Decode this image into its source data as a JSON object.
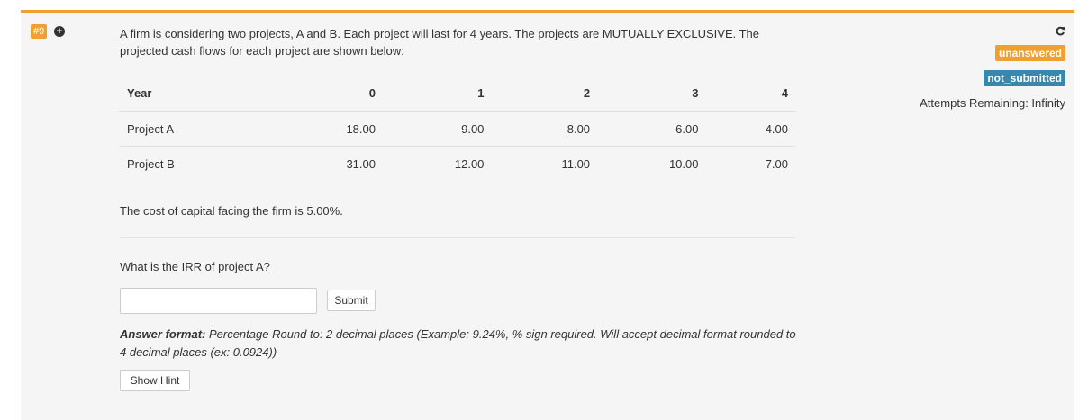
{
  "question": {
    "number": "#9",
    "intro": "A firm is considering two projects, A and B. Each project will last for 4 years. The projects are MUTUALLY EXCLUSIVE. The projected cash flows for each project are shown below:",
    "table": {
      "headers": [
        "Year",
        "0",
        "1",
        "2",
        "3",
        "4"
      ],
      "rows": [
        [
          "Project A",
          "-18.00",
          "9.00",
          "8.00",
          "6.00",
          "4.00"
        ],
        [
          "Project B",
          "-31.00",
          "12.00",
          "11.00",
          "10.00",
          "7.00"
        ]
      ]
    },
    "cost_of_capital": "The cost of capital facing the firm is 5.00%.",
    "prompt": "What is the IRR of project A?",
    "input_value": "",
    "submit_label": "Submit",
    "answer_format_label": "Answer format:",
    "answer_format_text": " Percentage Round to: 2 decimal places (Example: 9.24%, % sign required. Will accept decimal format rounded to 4 decimal places (ex: 0.0924))",
    "hint_label": "Show Hint"
  },
  "status": {
    "state_badge": "unanswered",
    "submission_badge": "not_submitted",
    "attempts": "Attempts Remaining: Infinity"
  },
  "colors": {
    "accent": "#f0a030",
    "info": "#3a87ad",
    "panel_bg": "#f5f5f5"
  },
  "icons": {
    "expand": "plus-circle-icon",
    "refresh": "reload-icon"
  }
}
